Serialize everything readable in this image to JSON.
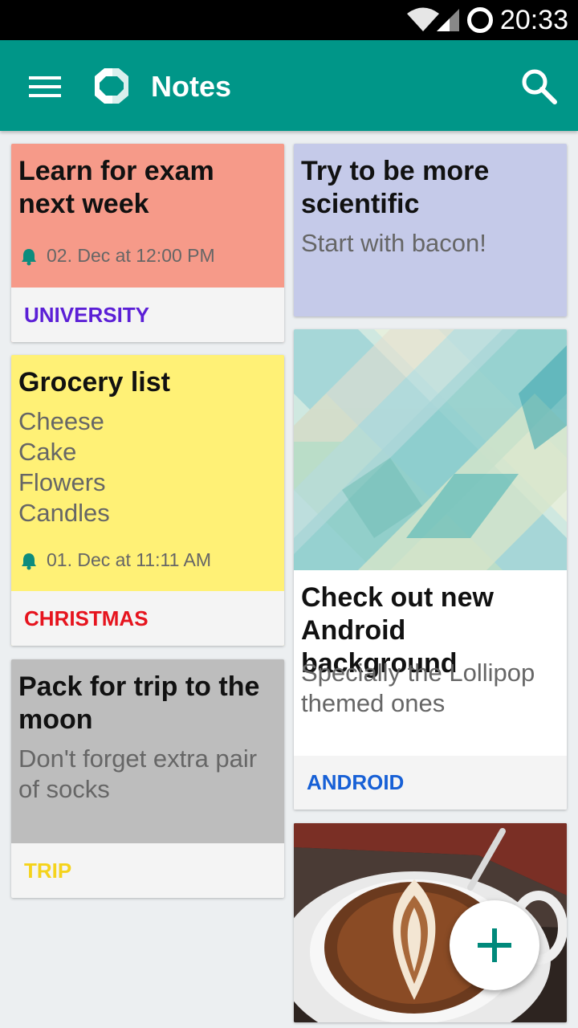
{
  "status_bar": {
    "time": "20:33"
  },
  "app_bar": {
    "title": "Notes"
  },
  "notes": [
    {
      "title": "Learn for exam next week",
      "reminder": "02. Dec at 12:00 PM",
      "label": "UNIVERSITY",
      "color": "#f69a89",
      "label_color": "#5b1fd6"
    },
    {
      "title": "Grocery list",
      "body_lines": [
        "Cheese",
        "Cake",
        "Flowers",
        "Candles"
      ],
      "reminder": "01. Dec at 11:11 AM",
      "label": "CHRISTMAS",
      "color": "#fff176",
      "label_color": "#e6141e"
    },
    {
      "title": "Pack for trip to the moon",
      "body": "Don't forget extra pair of socks",
      "label": "TRIP",
      "color": "#bdbdbd",
      "label_color": "#f5d31c"
    },
    {
      "title": "Try to be more scientific",
      "body": "Start with bacon!",
      "color": "#c5cae9"
    },
    {
      "title": "Check out new Android background",
      "body": "Specially the Lollipop themed ones",
      "label": "ANDROID",
      "color": "#ffffff",
      "label_color": "#1760d6"
    },
    {
      "image": "coffee-latte-art-photo"
    }
  ],
  "fab": {
    "icon": "plus-icon"
  }
}
